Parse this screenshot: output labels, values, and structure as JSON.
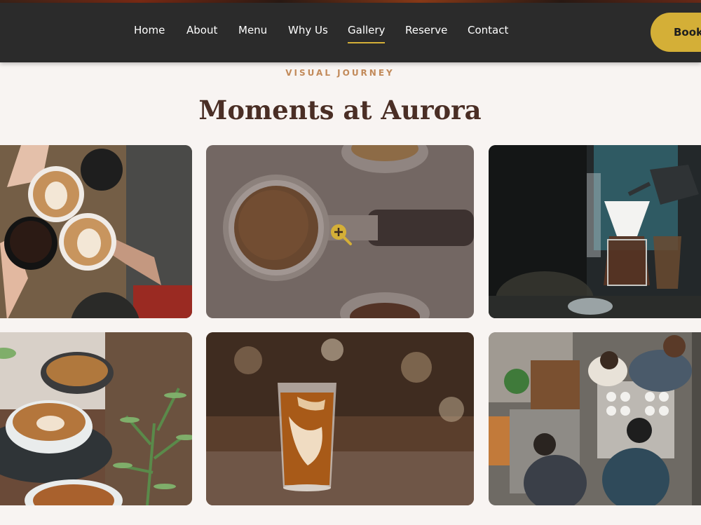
{
  "nav": {
    "items": [
      {
        "label": "Home",
        "active": false
      },
      {
        "label": "About",
        "active": false
      },
      {
        "label": "Menu",
        "active": false
      },
      {
        "label": "Why Us",
        "active": false
      },
      {
        "label": "Gallery",
        "active": true
      },
      {
        "label": "Reserve",
        "active": false
      },
      {
        "label": "Contact",
        "active": false
      }
    ],
    "book_label": "Book"
  },
  "gallery": {
    "eyebrow": "VISUAL JOURNEY",
    "title": "Moments at Aurora",
    "items": [
      {
        "subject": "hands-cheers-lattes"
      },
      {
        "subject": "espresso-portafilter-grounds",
        "hovered": true
      },
      {
        "subject": "pour-over-chemex-bar"
      },
      {
        "subject": "latte-cups-with-plant"
      },
      {
        "subject": "iced-coffee-glass"
      },
      {
        "subject": "baristas-overhead-counter"
      }
    ]
  },
  "colors": {
    "nav_bg": "#2b2b2b",
    "accent": "#d4af37",
    "eyebrow": "#c28a5a",
    "title": "#4a2e25",
    "page_bg": "#f8f4f2"
  }
}
